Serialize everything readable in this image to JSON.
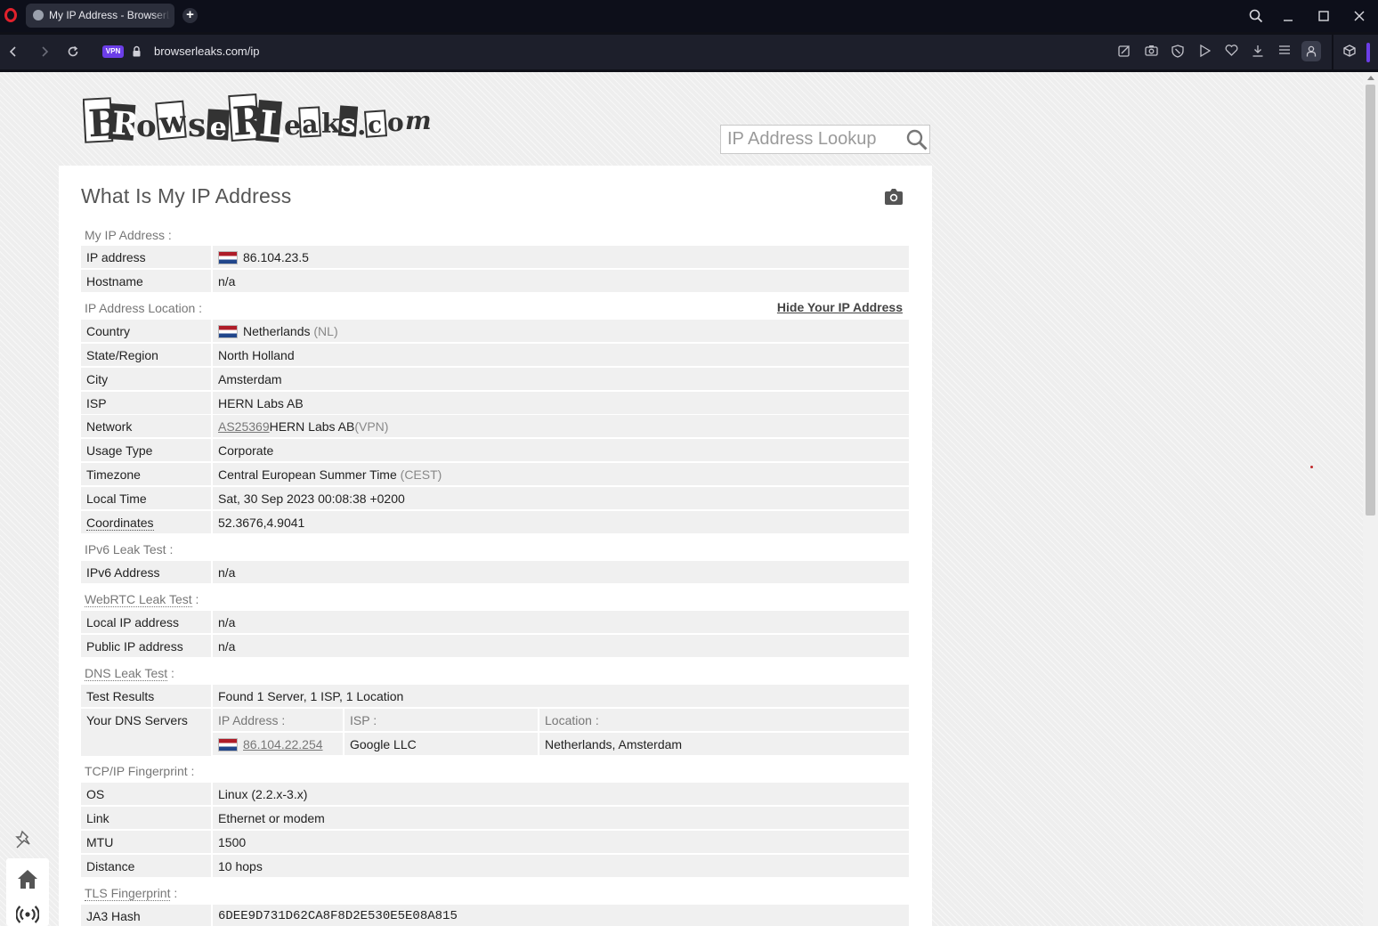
{
  "browser": {
    "tab_title": "My IP Address - BrowserLeaks",
    "new_tab_label": "+",
    "vpn_label": "VPN",
    "url": "browserleaks.com/ip"
  },
  "page": {
    "logo_text": "BrowserLeaks.com",
    "search": {
      "placeholder": "IP Address Lookup"
    },
    "title": "What Is My IP Address",
    "sections": {
      "my_ip": {
        "label": "My IP Address :",
        "rows": [
          {
            "key": "IP address",
            "value": "86.104.23.5"
          },
          {
            "key": "Hostname",
            "value": "n/a"
          }
        ]
      },
      "location": {
        "label": "IP Address Location :",
        "hide_link": "Hide Your IP Address",
        "rows": [
          {
            "key": "Country",
            "value": "Netherlands",
            "extra": "(NL)"
          },
          {
            "key": "State/Region",
            "value": "North Holland"
          },
          {
            "key": "City",
            "value": "Amsterdam"
          },
          {
            "key": "ISP",
            "value": "HERN Labs AB"
          },
          {
            "key": "Network",
            "asn": "AS25369",
            "value": "HERN Labs AB",
            "extra": "(VPN)"
          },
          {
            "key": "Usage Type",
            "value": "Corporate"
          },
          {
            "key": "Timezone",
            "value": "Central European Summer Time",
            "extra": "(CEST)"
          },
          {
            "key": "Local Time",
            "value": "Sat, 30 Sep 2023 00:08:38 +0200"
          },
          {
            "key": "Coordinates",
            "value": "52.3676,4.9041"
          }
        ]
      },
      "ipv6": {
        "label": "IPv6 Leak Test :",
        "rows": [
          {
            "key": "IPv6 Address",
            "value": "n/a"
          }
        ]
      },
      "webrtc": {
        "label_link": "WebRTC Leak Test",
        "label_suffix": " :",
        "rows": [
          {
            "key": "Local IP address",
            "value": "n/a"
          },
          {
            "key": "Public IP address",
            "value": "n/a"
          }
        ]
      },
      "dns": {
        "label_link": "DNS Leak Test",
        "label_suffix": " :",
        "rows": [
          {
            "key": "Test Results",
            "value": "Found 1 Server, 1 ISP, 1 Location"
          }
        ],
        "servers_key": "Your DNS Servers",
        "columns": [
          "IP Address :",
          "ISP :",
          "Location :"
        ],
        "servers": [
          {
            "ip": "86.104.22.254",
            "isp": "Google LLC",
            "location": "Netherlands, Amsterdam"
          }
        ]
      },
      "tcpip": {
        "label": "TCP/IP Fingerprint :",
        "rows": [
          {
            "key": "OS",
            "value": "Linux (2.2.x-3.x)"
          },
          {
            "key": "Link",
            "value": "Ethernet or modem"
          },
          {
            "key": "MTU",
            "value": "1500"
          },
          {
            "key": "Distance",
            "value": "10 hops"
          }
        ]
      },
      "tls": {
        "label_link": "TLS Fingerprint",
        "label_suffix": " :",
        "rows": [
          {
            "key": "JA3 Hash",
            "value": "6DEE9D731D62CA8F8D2E530E5E08A815"
          }
        ]
      }
    }
  },
  "icons": [
    "opera-logo-icon",
    "globe-icon",
    "search-icon",
    "minimize-icon",
    "maximize-icon",
    "close-icon",
    "back-icon",
    "forward-icon",
    "reload-icon",
    "lock-icon",
    "snapshot-icon",
    "camera-icon",
    "shield-icon",
    "play-icon",
    "heart-icon",
    "download-icon",
    "menu-icon",
    "profile-icon",
    "cube-icon",
    "pin-icon",
    "home-icon",
    "radio-icon"
  ],
  "colors": {
    "vpn_badge": "#6c3ee8",
    "opera_red": "#e0212c",
    "row_bg": "#f0f0f0"
  }
}
